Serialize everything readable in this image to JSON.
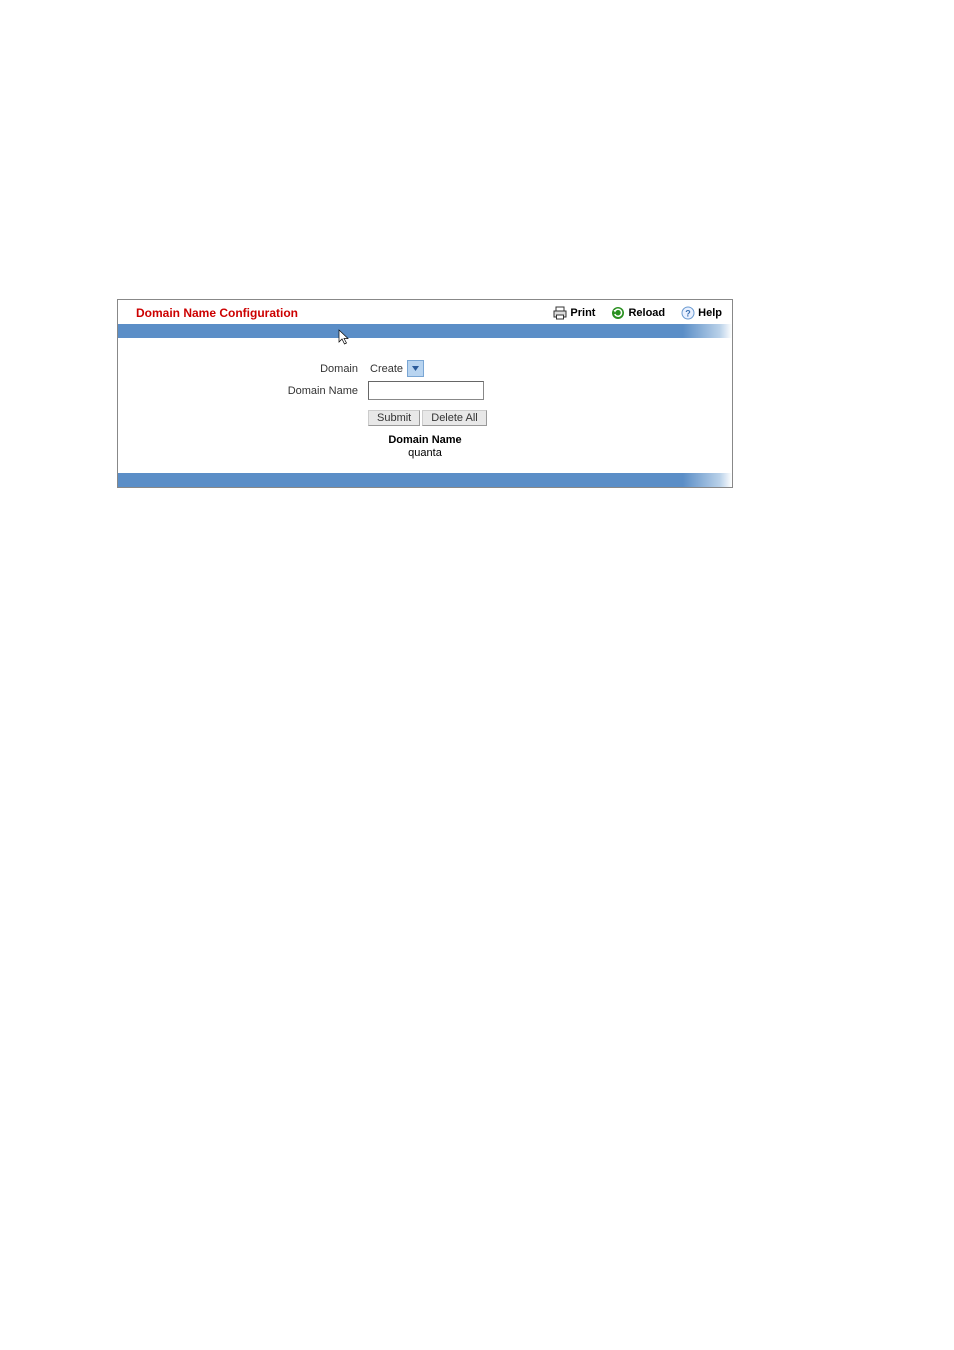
{
  "header": {
    "title": "Domain Name Configuration",
    "actions": {
      "print": "Print",
      "reload": "Reload",
      "help": "Help"
    }
  },
  "form": {
    "domain_label": "Domain",
    "domain_value": "Create",
    "domain_name_label": "Domain Name",
    "domain_name_value": ""
  },
  "buttons": {
    "submit": "Submit",
    "delete_all": "Delete All"
  },
  "result": {
    "title": "Domain Name",
    "value": "quanta"
  }
}
